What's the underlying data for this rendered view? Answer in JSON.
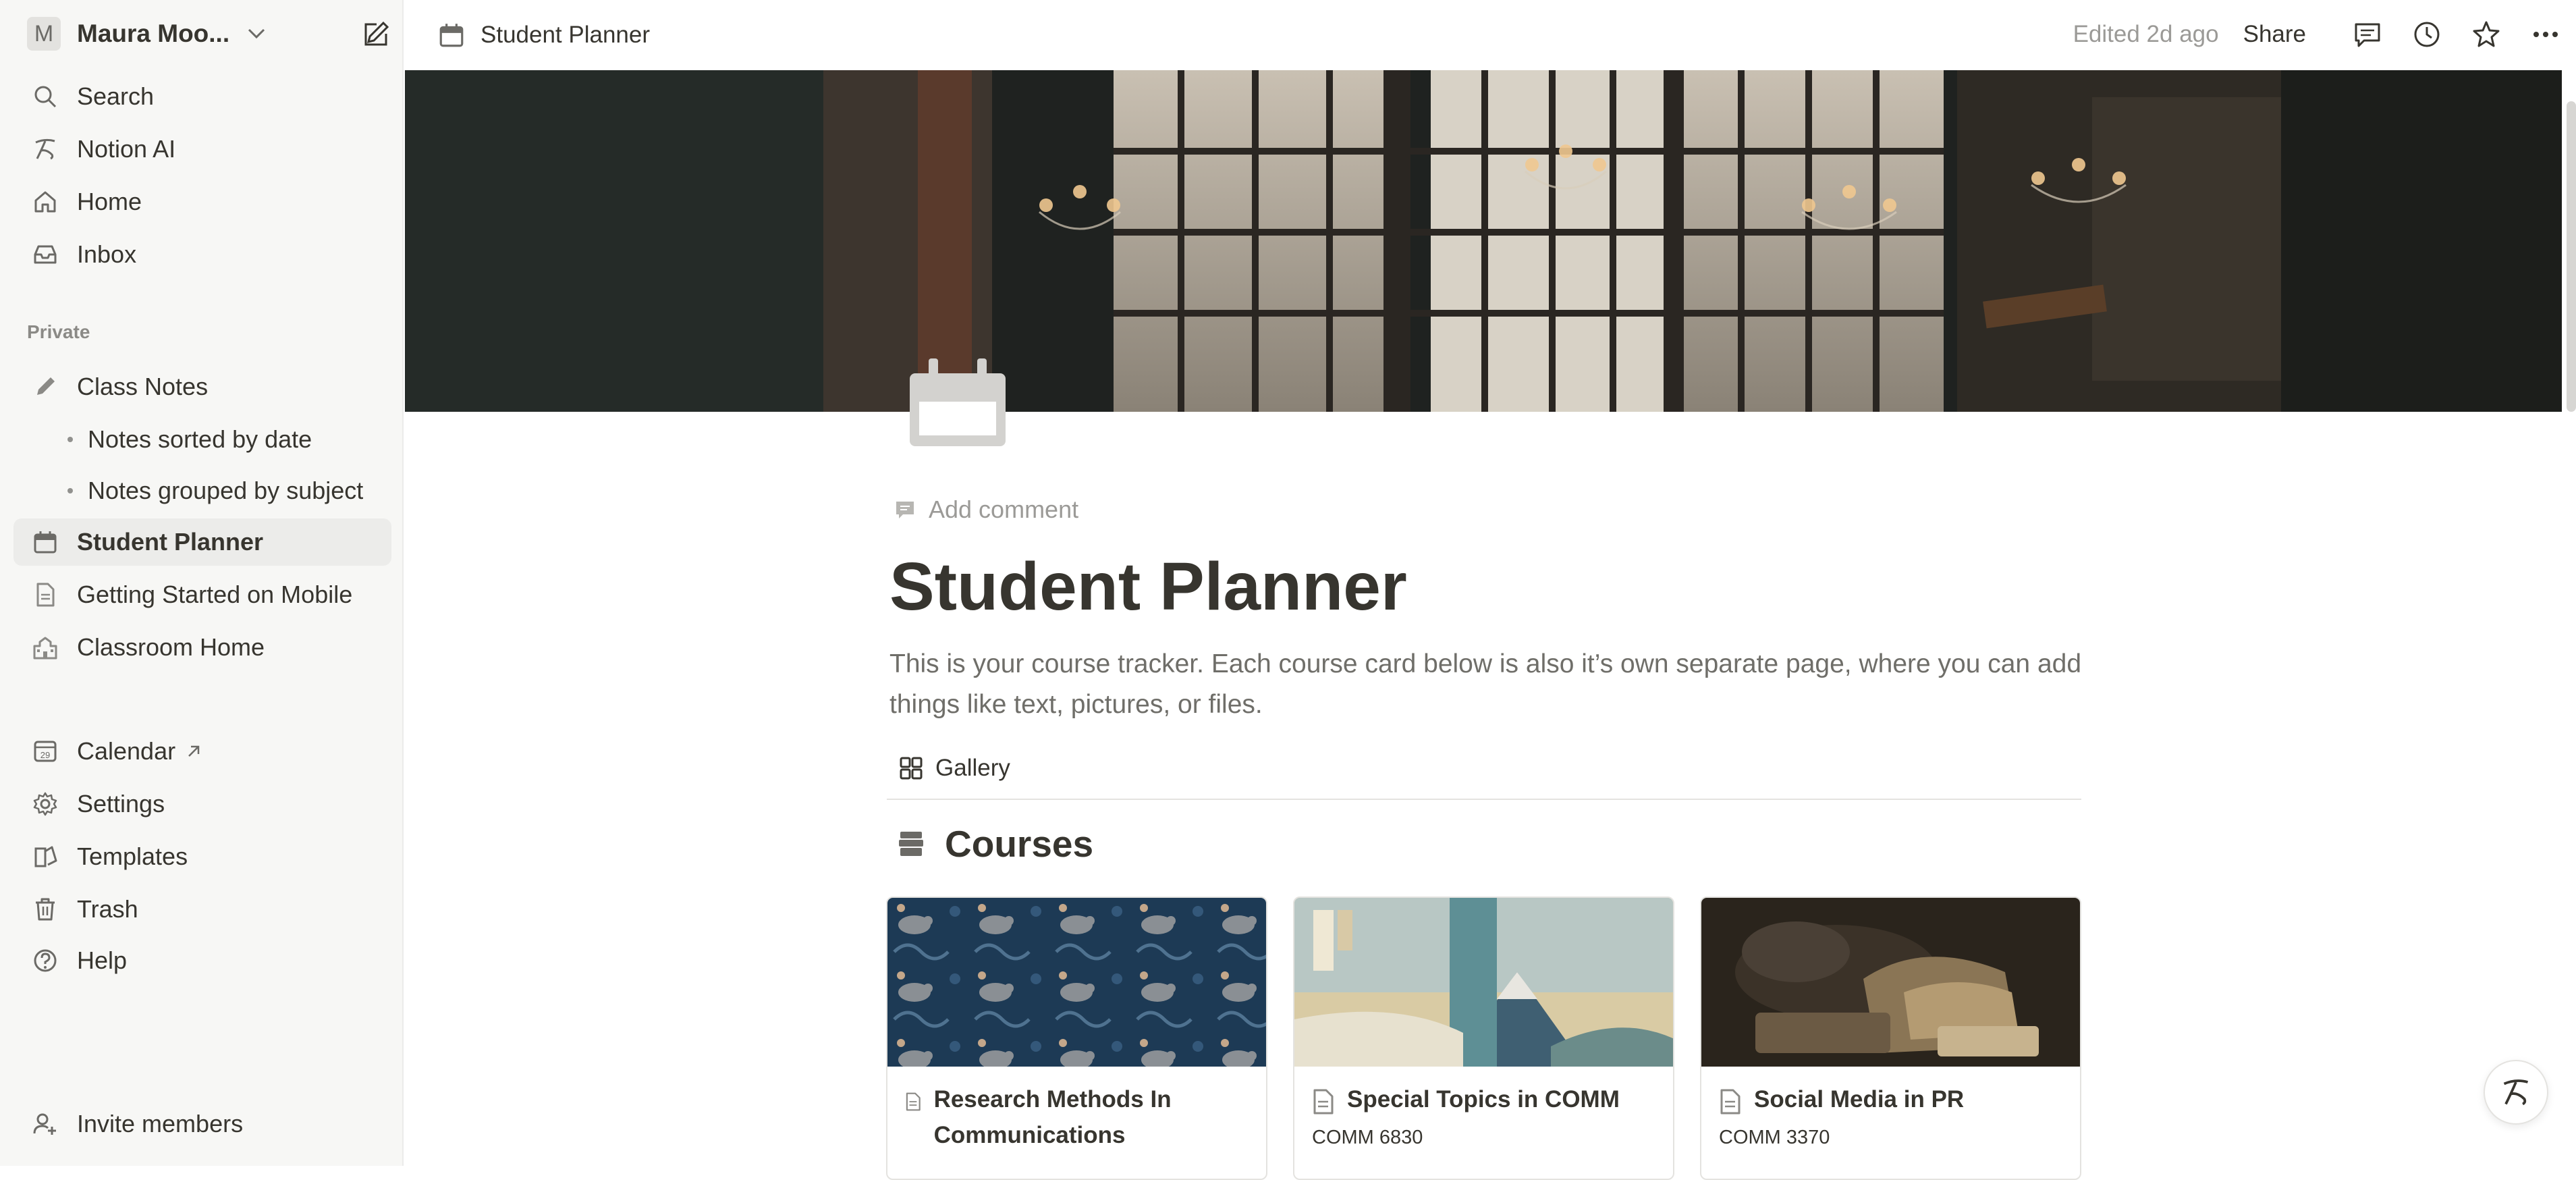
{
  "workspace": {
    "avatar_letter": "M",
    "name": "Maura Moo..."
  },
  "sidebar": {
    "top_items": [
      {
        "label": "Search",
        "icon": "search-icon"
      },
      {
        "label": "Notion AI",
        "icon": "notion-ai-icon"
      },
      {
        "label": "Home",
        "icon": "home-icon"
      },
      {
        "label": "Inbox",
        "icon": "inbox-icon"
      }
    ],
    "section_label": "Private",
    "pages": [
      {
        "label": "Class Notes",
        "icon": "pencil-icon"
      },
      {
        "label": "Notes sorted by date"
      },
      {
        "label": "Notes grouped by subject"
      },
      {
        "label": "Student Planner",
        "icon": "calendar-icon",
        "active": true
      },
      {
        "label": "Getting Started on Mobile",
        "icon": "page-icon"
      },
      {
        "label": "Classroom Home",
        "icon": "school-icon"
      }
    ],
    "bottom_items": [
      {
        "label": "Calendar",
        "icon": "calendar-29-icon",
        "external": true
      },
      {
        "label": "Settings",
        "icon": "gear-icon"
      },
      {
        "label": "Templates",
        "icon": "templates-icon"
      },
      {
        "label": "Trash",
        "icon": "trash-icon"
      },
      {
        "label": "Help",
        "icon": "help-icon"
      }
    ],
    "invite_label": "Invite members"
  },
  "topbar": {
    "breadcrumb": "Student Planner",
    "edited": "Edited 2d ago",
    "share": "Share"
  },
  "page": {
    "add_comment": "Add comment",
    "title": "Student Planner",
    "description": "This is your course tracker. Each course card below is also it’s own separate page, where you can add things like text, pictures, or files.",
    "view_tab": "Gallery",
    "database_title": "Courses"
  },
  "cards": [
    {
      "title": "Research Methods In Communications",
      "code": ""
    },
    {
      "title": "Special Topics in COMM",
      "code": "COMM 6830"
    },
    {
      "title": "Social Media in PR",
      "code": "COMM 3370"
    }
  ],
  "colors": {
    "text": "#37352f",
    "muted": "#9b9a97",
    "sidebar_bg": "#f7f7f5"
  }
}
